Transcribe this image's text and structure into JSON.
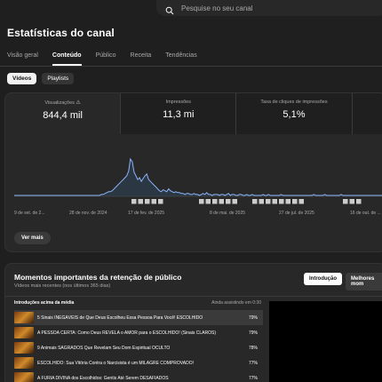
{
  "search": {
    "placeholder": "Pesquise no seu canal"
  },
  "page": {
    "title": "Estatísticas do canal"
  },
  "tabs": [
    "Visão geral",
    "Conteúdo",
    "Público",
    "Receita",
    "Tendências"
  ],
  "chips": [
    "Vídeos",
    "Playlists"
  ],
  "metrics": [
    {
      "label": "Visualizações",
      "value": "844,4 mil",
      "warning": true
    },
    {
      "label": "Impressões",
      "value": "11,3 mi"
    },
    {
      "label": "Taxa de cliques de impressões",
      "value": "5,1%"
    }
  ],
  "chart_data": {
    "type": "line",
    "x_tick_labels": [
      "9 de set. de 2...",
      "28 de nov. de 2024",
      "17 de fev. de 2025",
      "8 de mai. de 2025",
      "27 de jul. de 2025",
      "16 de out. de ..."
    ],
    "values": [
      1,
      1,
      1,
      1,
      1,
      1,
      1,
      1,
      1,
      1,
      1,
      1,
      1,
      1,
      1,
      1,
      1,
      1,
      1,
      1,
      1,
      1,
      1,
      1,
      1,
      1,
      1,
      1,
      1,
      1,
      1,
      1,
      1,
      1,
      1,
      1,
      1,
      1,
      1,
      1,
      1,
      1,
      1,
      1,
      1,
      1,
      1,
      1,
      2,
      2,
      3,
      4,
      5,
      5,
      6,
      8,
      10,
      12,
      14,
      16,
      18,
      20,
      22,
      27,
      40,
      37,
      26,
      22,
      18,
      20,
      16,
      19,
      22,
      24,
      18,
      16,
      14,
      12,
      10,
      8,
      6,
      5,
      7,
      6,
      5,
      8,
      6,
      5,
      4,
      5,
      4,
      4,
      3,
      3,
      2,
      3,
      3,
      2,
      2,
      3,
      2,
      2,
      1,
      2,
      3,
      2,
      4,
      2,
      2,
      1,
      2,
      2,
      2,
      1,
      2,
      2,
      1,
      2,
      3,
      1,
      2,
      2,
      1,
      1,
      2,
      2,
      1,
      1,
      2,
      1,
      1,
      2,
      1,
      1,
      1,
      1,
      1,
      2,
      1,
      1,
      2,
      1,
      1,
      1,
      1,
      1,
      1,
      2,
      1,
      1,
      1,
      1,
      1,
      1,
      1,
      1,
      1,
      1,
      1,
      1,
      1,
      1,
      1,
      1,
      1,
      2,
      1,
      1,
      1,
      1,
      1,
      2,
      1,
      1,
      1,
      1,
      1,
      1,
      1,
      1,
      2,
      1,
      1,
      1,
      1,
      1,
      1,
      1,
      1,
      1,
      1,
      1,
      1,
      1,
      1,
      1,
      1,
      1,
      1,
      1,
      1,
      1,
      1,
      1
    ],
    "color": "#3ea6ff",
    "title": "",
    "xlabel": "",
    "ylabel": "",
    "grid": false
  },
  "see_more": "Ver mais",
  "retention": {
    "title": "Momentos importantes da retenção de público",
    "subtitle": "Vídeos mais recentes (nos últimos 365 dias)",
    "btn_intro": "Introdução",
    "btn_best": "Melhores mom",
    "head_left": "Introduções acima da média",
    "head_right": "Ainda assistindo em 0:30",
    "rows": [
      {
        "title": "5 Sinais INEGÁVEIS de Que Deus Escolheu Essa Pessoa Para Você! ESCOLHIDO",
        "pct": "79%"
      },
      {
        "title": "A PESSOA CERTA: Como Deus REVELA o AMOR para o ESCOLHIDO! (Sinais CLAROS)",
        "pct": "79%"
      },
      {
        "title": "9 Animais SAGRADOS Que Revelam Seu Dom Espiritual OCULTO",
        "pct": "78%"
      },
      {
        "title": "ESCOLHIDO: Sua Vitória Contra o Narcisista é um MILAGRE COMPROVADO!",
        "pct": "77%"
      },
      {
        "title": "A FÚRIA DIVINA dos Escolhidos: Gentis Até Serem DESAFIADOS",
        "pct": "77%"
      }
    ]
  }
}
